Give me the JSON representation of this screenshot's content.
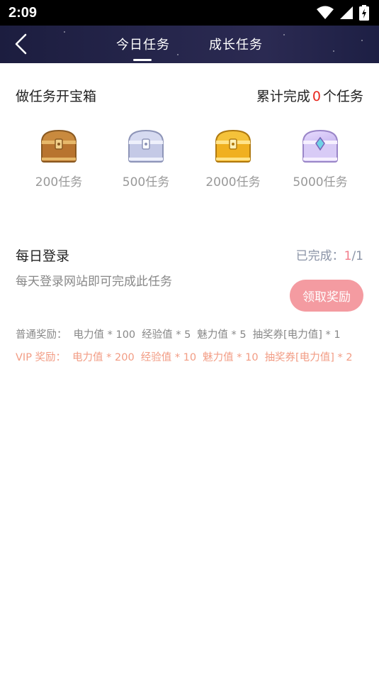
{
  "status_bar": {
    "time": "2:09"
  },
  "header": {
    "tabs": [
      {
        "label": "今日任务",
        "active": true
      },
      {
        "label": "成长任务",
        "active": false
      }
    ]
  },
  "treasure": {
    "title": "做任务开宝箱",
    "progress_prefix": "累计完成",
    "progress_count": "0",
    "progress_suffix": "个任务",
    "chests": [
      {
        "label": "200任务",
        "icon": "bronze-chest-icon"
      },
      {
        "label": "500任务",
        "icon": "silver-chest-icon"
      },
      {
        "label": "2000任务",
        "icon": "gold-chest-icon"
      },
      {
        "label": "5000任务",
        "icon": "crystal-chest-icon"
      }
    ]
  },
  "task": {
    "title": "每日登录",
    "status_label": "已完成：",
    "done": "1",
    "total": "/1",
    "description": "每天登录网站即可完成此任务",
    "button_label": "领取奖励",
    "normal_rewards": {
      "label": "普通奖励：",
      "items": [
        "电力值 * 100",
        "经验值 * 5",
        "魅力值 * 5",
        "抽奖券[电力值] * 1"
      ]
    },
    "vip_rewards": {
      "label": "VIP 奖励：",
      "items": [
        "电力值 * 200",
        "经验值 * 10",
        "魅力值 * 10",
        "抽奖券[电力值] * 2"
      ]
    }
  },
  "colors": {
    "accent_red": "#e8281f",
    "button_pink": "#f49ba1",
    "vip_orange": "#f29c84",
    "header_navy": "#26264c"
  }
}
